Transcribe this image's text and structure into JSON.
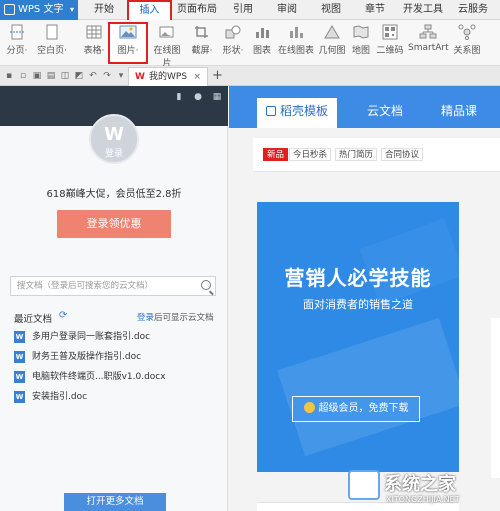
{
  "app": {
    "title": "WPS 文字",
    "caret": "▾"
  },
  "menu": {
    "items": [
      "开始",
      "插入",
      "页面布局",
      "引用",
      "审阅",
      "视图",
      "章节",
      "开发工具",
      "云服务"
    ]
  },
  "ribbon": {
    "items": [
      {
        "label": "分页·",
        "icon": "page-break-icon"
      },
      {
        "label": "空白页·",
        "icon": "blank-page-icon"
      },
      {
        "label": "表格·",
        "icon": "table-icon"
      },
      {
        "label": "图片·",
        "icon": "image-icon"
      },
      {
        "label": "在线图片",
        "icon": "online-image-icon"
      },
      {
        "label": "截屏·",
        "icon": "screenshot-icon"
      },
      {
        "label": "形状·",
        "icon": "shape-icon"
      },
      {
        "label": "图表",
        "icon": "chart-icon"
      },
      {
        "label": "在线图表",
        "icon": "online-chart-icon"
      },
      {
        "label": "几何图",
        "icon": "geometry-icon"
      },
      {
        "label": "地图",
        "icon": "map-icon"
      },
      {
        "label": "二维码",
        "icon": "qrcode-icon"
      },
      {
        "label": "SmartArt",
        "icon": "smartart-icon"
      },
      {
        "label": "关系图",
        "icon": "relation-icon"
      }
    ]
  },
  "tabs": {
    "doc_tab": "我的WPS",
    "doc_tab_close": "×",
    "add": "+"
  },
  "sidebar": {
    "avatar_label": "登录",
    "promo": "618巅峰大促，会员低至2.8折",
    "login_button": "登录领优惠",
    "search_placeholder": "搜文档（登录后可搜索您的云文档）",
    "recent_title": "最近文档",
    "recent_tip_link": "登录",
    "recent_tip_text": "后可显示云文档",
    "files": [
      "多用户登录同一账套指引.doc",
      "财务王普及版操作指引.doc",
      "电脑软件终端页...职版v1.0.docx",
      "安装指引.doc"
    ],
    "open_more": "打开更多文档"
  },
  "right_panel": {
    "tabs": [
      "稻壳模板",
      "云文档",
      "精品课"
    ],
    "tags": [
      "新品",
      "今日秒杀",
      "热门简历",
      "合同协议"
    ],
    "banner": {
      "title": "营销人必学技能",
      "subtitle": "面对消费者的销售之道",
      "button": "超级会员，免费下载"
    }
  },
  "watermark": {
    "text": "系统之家",
    "url": "XITONGZHIJIA.NET"
  },
  "colors": {
    "accent": "#3d8be4",
    "app_blue": "#2f7fd0",
    "highlight": "#e02020",
    "login_btn": "#ef8271",
    "sidebar_dark": "#2c3846"
  }
}
